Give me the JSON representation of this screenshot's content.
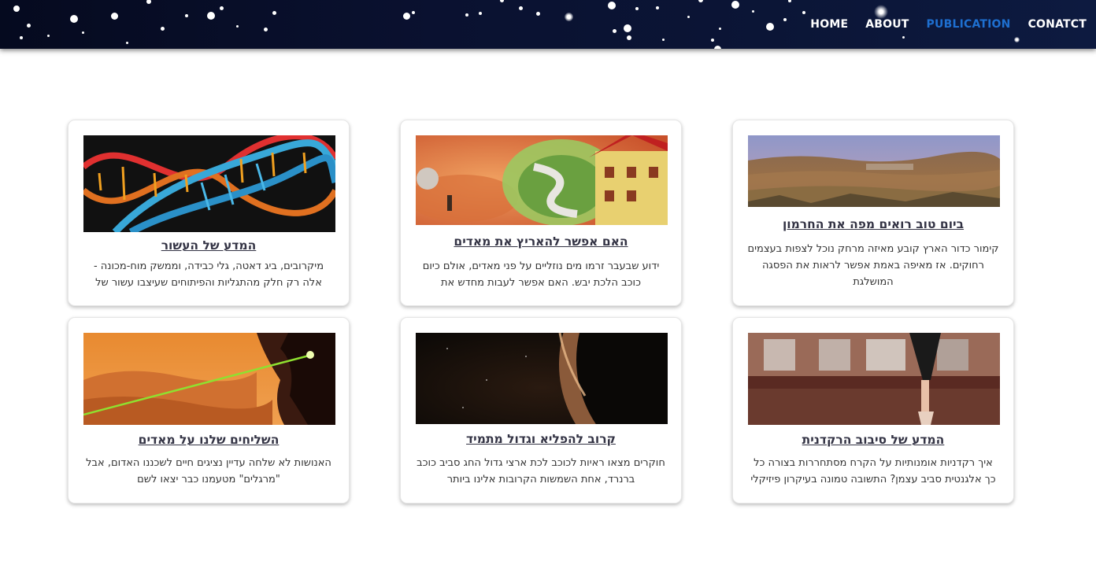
{
  "nav": {
    "items": [
      {
        "label": "HOME"
      },
      {
        "label": "ABOUT"
      },
      {
        "label": "PUBLICATION"
      },
      {
        "label": "CONATCT"
      }
    ],
    "active_color": "#1e6fd0"
  },
  "cards": [
    {
      "title": "ביום טוב רואים מפה את החרמון",
      "description": "קימור כדור הארץ קובע מאיזה מרחק נוכל לצפות בעצמים רחוקים. אז מאיפה באמת אפשר לראות את הפסגה המושלגת",
      "image": "landscape-image"
    },
    {
      "title": "האם אפשר להאריץ את מאדים",
      "description": "ידוע שבעבר זרמו מים נוזליים על פני מאדים, אולם כיום כוכב הלכת יבש. האם אפשר לעבות מחדש את האטמוספרה של",
      "image": "mars-terraform-image"
    },
    {
      "title": "המדע של העשור",
      "description": "מיקרובים, ביג דאטה, גלי כבידה, וממשק מוח-מכונה - אלה רק חלק מהתגליות והפיתוחים שעיצבו עשור של פריצות דרך",
      "image": "dna-image"
    },
    {
      "title": "המדע של סיבוב הרקדנית",
      "description": "איך רקדניות אומנותיות על הקרח מסתחררות בצורה כל כך אלגנטית סביב עצמן? התשובה טמונה בעיקרון פיזיקלי",
      "image": "dancer-image"
    },
    {
      "title": "קרוב להפליא וגדול מתמיד",
      "description": "חוקרים מצאו ראיות לכוכב לכת ארצי גדול החג סביב כוכב ברנרד, אחת השמשות הקרובות אלינו ביותר",
      "image": "planet-image"
    },
    {
      "title": "השליחים שלנו על מאדים",
      "description": "האנושות לא שלחה עדיין נציגים חיים לשכננו האדום, אבל \"מרגלים\" מטעמנו כבר יצאו לשם",
      "image": "mars-laser-image"
    }
  ]
}
